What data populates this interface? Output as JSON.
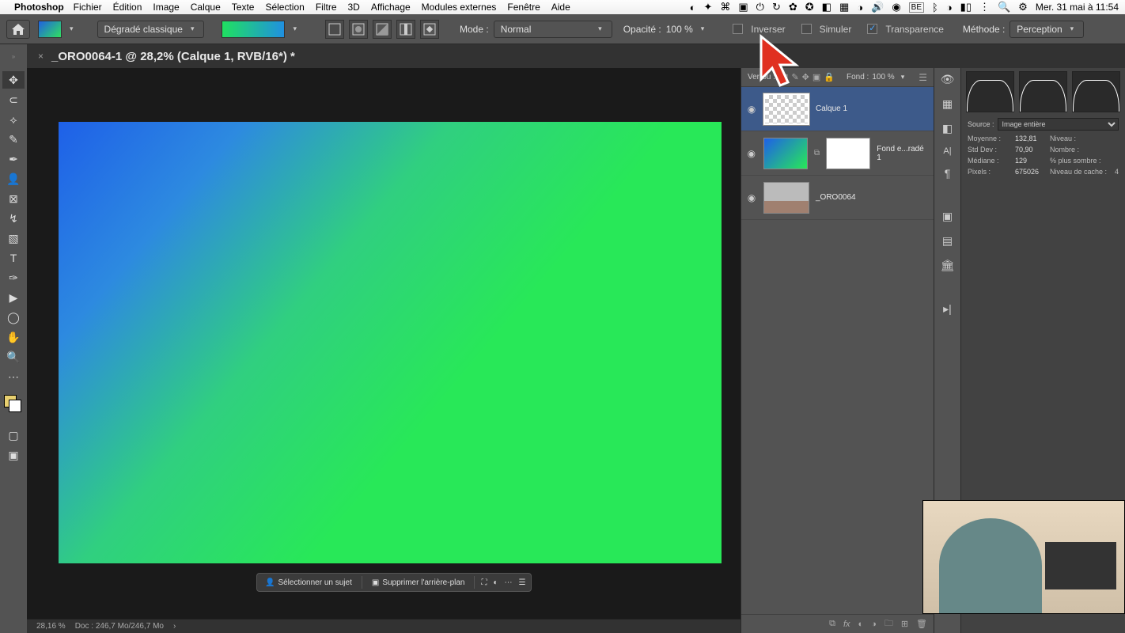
{
  "menubar": {
    "app": "Photoshop",
    "items": [
      "Fichier",
      "Édition",
      "Image",
      "Calque",
      "Texte",
      "Sélection",
      "Filtre",
      "3D",
      "Affichage",
      "Modules externes",
      "Fenêtre",
      "Aide"
    ],
    "clock": "Mer. 31 mai à 11:54",
    "lang": "BE"
  },
  "options": {
    "gradient_type": "Dégradé classique",
    "mode_label": "Mode :",
    "mode_value": "Normal",
    "opacity_label": "Opacité :",
    "opacity_value": "100 %",
    "inverser": "Inverser",
    "simuler": "Simuler",
    "transparence": "Transparence",
    "methode_label": "Méthode :",
    "methode_value": "Perception"
  },
  "tab": {
    "title": "_ORO0064-1 @ 28,2% (Calque 1, RVB/16*) *"
  },
  "layers": {
    "verrou_label": "Verrou :",
    "fond_label": "Fond :",
    "fond_value": "100 %",
    "items": [
      {
        "name": "Calque 1",
        "thumb": "trans",
        "selected": true
      },
      {
        "name": "Fond e...radé 1",
        "thumb": "grad",
        "mask": true
      },
      {
        "name": "_ORO0064",
        "thumb": "img"
      }
    ]
  },
  "info": {
    "source_label": "Source :",
    "source_value": "Image entière",
    "stats": {
      "moyenne_l": "Moyenne :",
      "moyenne_v": "132,81",
      "niveau_l": "Niveau :",
      "niveau_v": "",
      "stddev_l": "Std Dev :",
      "stddev_v": "70,90",
      "nombre_l": "Nombre :",
      "nombre_v": "",
      "mediane_l": "Médiane :",
      "mediane_v": "129",
      "sombre_l": "% plus sombre :",
      "sombre_v": "",
      "pixels_l": "Pixels :",
      "pixels_v": "675026",
      "cache_l": "Niveau de cache :",
      "cache_v": "4"
    }
  },
  "context_bar": {
    "select_subject": "Sélectionner un sujet",
    "remove_bg": "Supprimer l'arrière-plan"
  },
  "status": {
    "zoom": "28,16 %",
    "doc": "Doc : 246,7 Mo/246,7 Mo"
  }
}
